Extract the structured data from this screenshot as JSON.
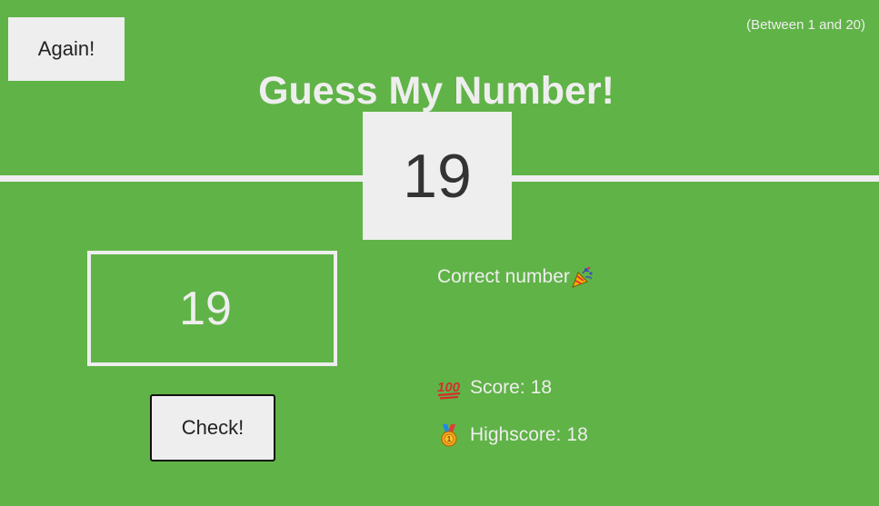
{
  "header": {
    "again_label": "Again!",
    "range_hint": "(Between 1 and 20)",
    "title": "Guess My Number!",
    "secret_number": "19"
  },
  "game": {
    "guess_value": "19",
    "check_label": "Check!",
    "message": "Correct number",
    "message_icon": "party-popper-icon",
    "score_icon": "hundred-points-icon",
    "score_label": "Score:",
    "score_value": "18",
    "highscore_icon": "medal-icon",
    "highscore_label": "Highscore:",
    "highscore_value": "18"
  },
  "colors": {
    "background": "#60b347",
    "light": "#eeeeee",
    "number_text": "#333333"
  }
}
